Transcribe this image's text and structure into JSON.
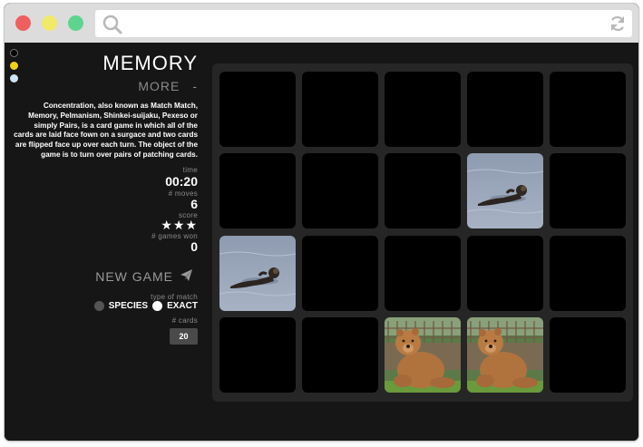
{
  "app": {
    "title": "MEMORY",
    "more_label": "MORE",
    "more_toggle": "-",
    "description": "Concentration, also known as Match Match, Memory, Pelmanism, Shinkei-suijaku, Pexeso or simply Pairs, is a card game in which all of the cards are laid face fown on a surgace and two cards are flipped face up over each turn. The object of the game is to turn over pairs of patching cards."
  },
  "stats": {
    "time_label": "time",
    "time_value": "00:20",
    "moves_label": "# moves",
    "moves_value": "6",
    "score_label": "score",
    "score_stars": "★★★",
    "score_rating": 3,
    "games_won_label": "# games won",
    "games_won_value": "0"
  },
  "controls": {
    "new_game_label": "NEW GAME",
    "match_type_label": "type of match",
    "options": [
      "SPECIES",
      "EXACT"
    ],
    "selected_option": "EXACT",
    "cards_label": "# cards",
    "cards_value": "20"
  },
  "theme_colors": [
    "#000000",
    "#f1d21a",
    "#cfe4f4"
  ],
  "board": {
    "rows": 4,
    "cols": 5,
    "cards": [
      {
        "state": "down"
      },
      {
        "state": "down"
      },
      {
        "state": "down"
      },
      {
        "state": "down"
      },
      {
        "state": "down"
      },
      {
        "state": "down"
      },
      {
        "state": "down"
      },
      {
        "state": "down"
      },
      {
        "state": "up",
        "image": "sea-otter"
      },
      {
        "state": "down"
      },
      {
        "state": "up",
        "image": "sea-otter"
      },
      {
        "state": "down"
      },
      {
        "state": "down"
      },
      {
        "state": "down"
      },
      {
        "state": "down"
      },
      {
        "state": "down"
      },
      {
        "state": "down"
      },
      {
        "state": "up",
        "image": "brown-bear"
      },
      {
        "state": "up",
        "image": "brown-bear"
      },
      {
        "state": "down"
      }
    ]
  }
}
